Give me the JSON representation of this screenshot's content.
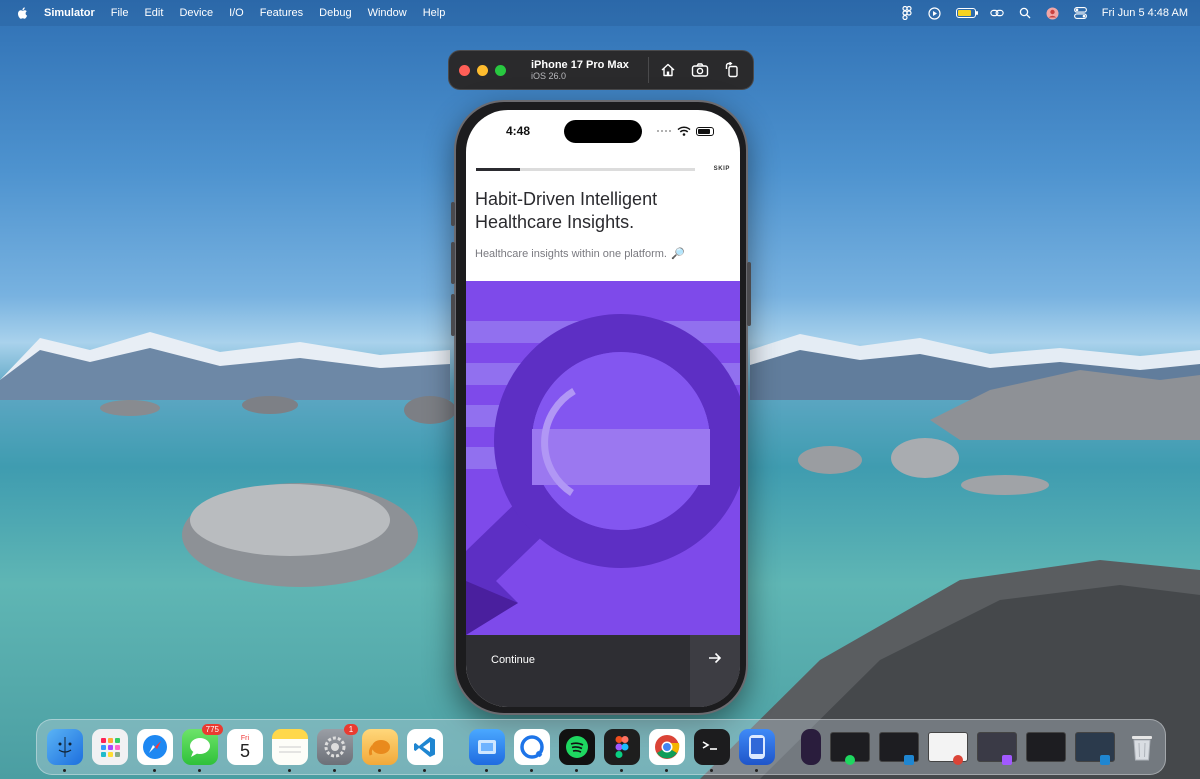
{
  "menubar": {
    "app_name": "Simulator",
    "items": [
      "File",
      "Edit",
      "Device",
      "I/O",
      "Features",
      "Debug",
      "Window",
      "Help"
    ],
    "clock": "Fri Jun 5  4:48 AM"
  },
  "simulator": {
    "device_name": "iPhone 17 Pro Max",
    "os_version": "iOS 26.0",
    "tools": [
      "home-icon",
      "screenshot-icon",
      "rotate-icon"
    ]
  },
  "app": {
    "status_time": "4:48",
    "progress": 0.2,
    "skip_label": "SKIP",
    "headline": "Habit-Driven Intelligent Healthcare Insights.",
    "subhead": "Healthcare insights within one platform.",
    "subhead_emoji": "🔎",
    "continue_label": "Continue",
    "colors": {
      "illustration_bg": "#7e4aea",
      "lens_ring": "#5d2fc4",
      "stripe": "#9b78f0",
      "cta_bg": "#2e2e33"
    }
  },
  "dock": {
    "messages_badge": "775",
    "settings_badge": "1",
    "calendar_day": "Fri",
    "calendar_date": "5"
  }
}
